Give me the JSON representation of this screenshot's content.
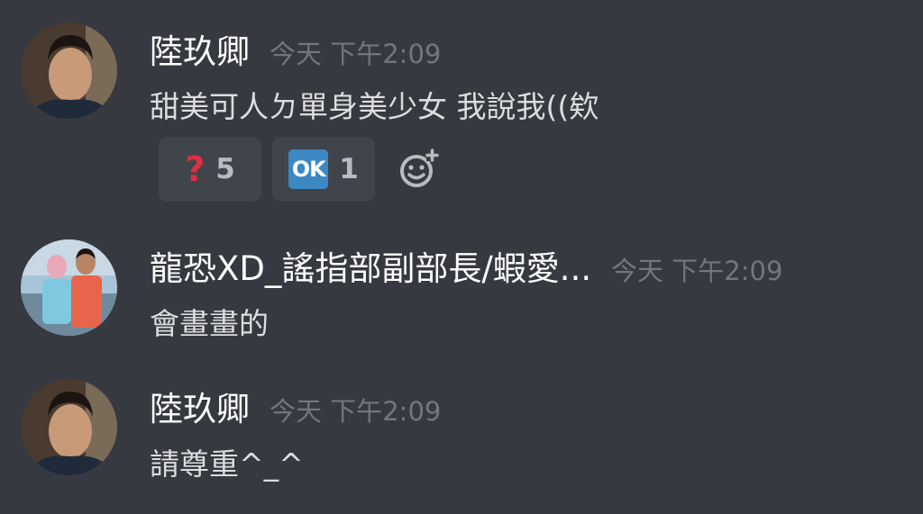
{
  "messages": [
    {
      "username": "陸玖卿",
      "timestamp": "今天 下午2:09",
      "content": "甜美可人ㄉ單身美少女 我說我((欸",
      "avatar": "man-dark-shirt-portrait",
      "reactions": [
        {
          "emoji": "question-mark-emoji",
          "symbol": "?",
          "count": "5"
        },
        {
          "emoji": "ok-button-emoji",
          "symbol": "OK",
          "count": "1"
        }
      ]
    },
    {
      "username": "龍恐XD_謠指部副部長/蝦愛...",
      "timestamp": "今天 下午2:09",
      "content": "會畫畫的",
      "avatar": "two-people-outdoor-photo"
    },
    {
      "username": "陸玖卿",
      "timestamp": "今天 下午2:09",
      "content": "請尊重^_^",
      "avatar": "man-dark-shirt-portrait"
    }
  ],
  "add_reaction_icon": "add-reaction-icon",
  "colors": {
    "background": "#36393f",
    "username": "#ffffff",
    "timestamp": "#72767d",
    "content": "#dcddde",
    "reaction_bg": "#40444b",
    "reaction_count": "#b9bbbe"
  }
}
